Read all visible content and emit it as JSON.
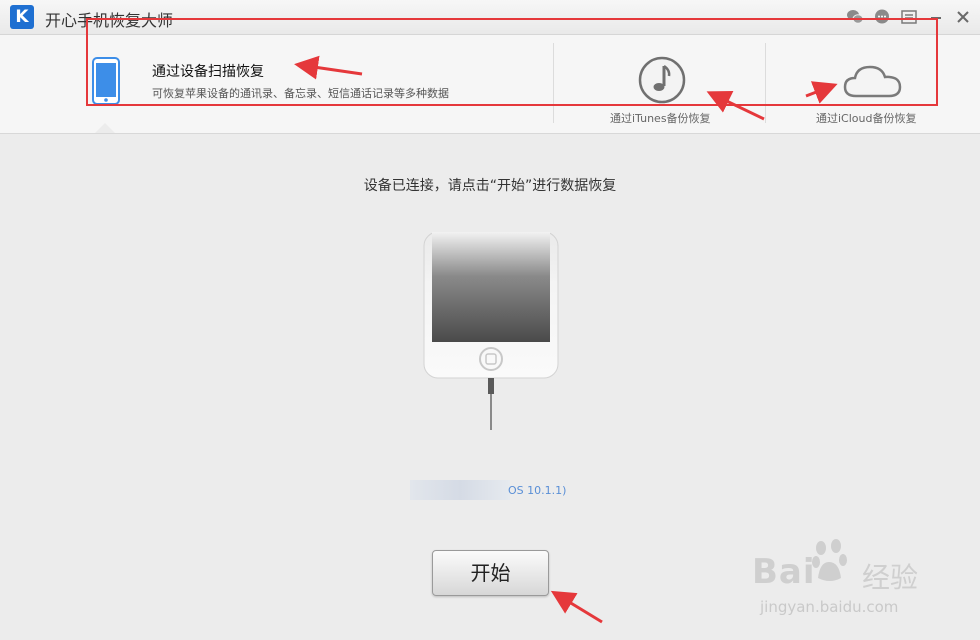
{
  "window": {
    "logo_letter": "K",
    "title": "开心手机恢复大师"
  },
  "tabs": {
    "device": {
      "title": "通过设备扫描恢复",
      "description": "可恢复苹果设备的通讯录、备忘录、短信通话记录等多种数据"
    },
    "itunes": {
      "label": "通过iTunes备份恢复"
    },
    "icloud": {
      "label": "通过iCloud备份恢复"
    }
  },
  "main": {
    "status_message": "设备已连接，请点击“开始”进行数据恢复",
    "device_info": "OS 10.1.1)",
    "start_button": "开始"
  },
  "watermark": {
    "brand": "Bai",
    "suffix": "经验",
    "url": "jingyan.baidu.com"
  },
  "colors": {
    "accent": "#1e6fd1",
    "annotation": "#e5383b",
    "link": "#5a8fd6"
  }
}
